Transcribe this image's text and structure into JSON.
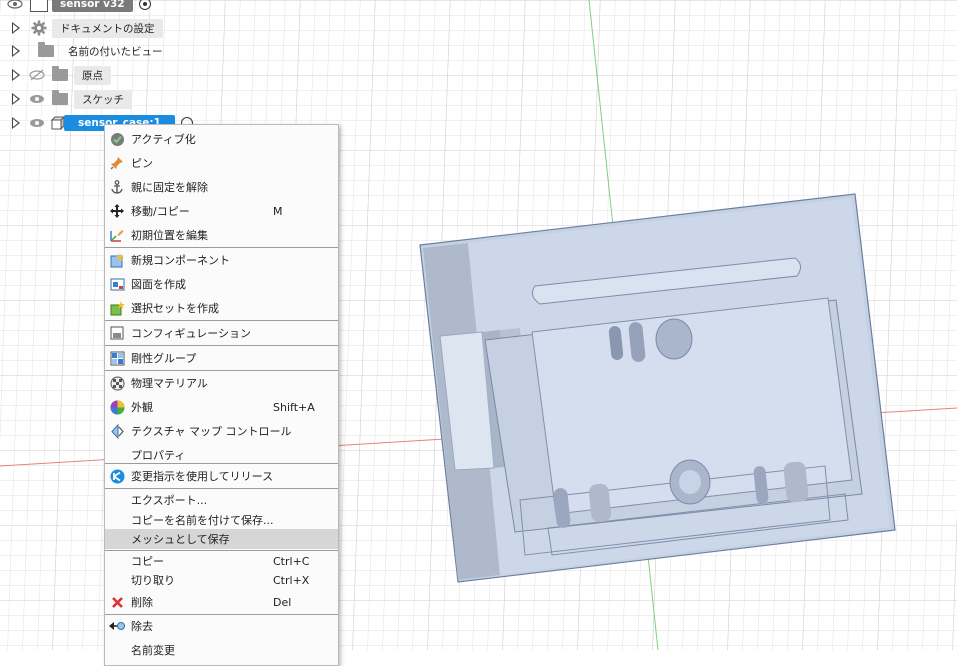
{
  "browser": {
    "root": {
      "label": "sensor v32"
    },
    "items": [
      {
        "label": "ドキュメントの設定",
        "icon": "gear-icon"
      },
      {
        "label": "名前の付いたビュー",
        "icon": "folder-icon"
      },
      {
        "label": "原点",
        "icon": "folder-icon",
        "visibility": "hidden"
      },
      {
        "label": "スケッチ",
        "icon": "folder-icon",
        "visibility": "visible"
      },
      {
        "label": "sensor_case:1",
        "icon": "component-icon",
        "visibility": "visible",
        "selected": true
      }
    ]
  },
  "context_menu": {
    "items": [
      {
        "label": "アクティブ化",
        "icon": "activate-check-icon",
        "shortcut": ""
      },
      {
        "label": "ピン",
        "icon": "pin-icon",
        "shortcut": ""
      },
      {
        "label": "親に固定を解除",
        "icon": "anchor-icon",
        "shortcut": ""
      },
      {
        "label": "移動/コピー",
        "icon": "move-icon",
        "shortcut": "M"
      },
      {
        "label": "初期位置を編集",
        "icon": "edit-position-icon",
        "shortcut": ""
      },
      {
        "label": "新規コンポーネント",
        "icon": "new-component-icon",
        "shortcut": ""
      },
      {
        "label": "図面を作成",
        "icon": "drawing-icon",
        "shortcut": ""
      },
      {
        "label": "選択セットを作成",
        "icon": "selection-set-icon",
        "shortcut": ""
      },
      {
        "label": "コンフィギュレーション",
        "icon": "configuration-icon",
        "shortcut": ""
      },
      {
        "label": "剛性グループ",
        "icon": "rigid-group-icon",
        "shortcut": ""
      },
      {
        "label": "物理マテリアル",
        "icon": "material-icon",
        "shortcut": ""
      },
      {
        "label": "外観",
        "icon": "appearance-icon",
        "shortcut": "Shift+A"
      },
      {
        "label": "テクスチャ マップ コントロール",
        "icon": "texture-map-icon",
        "shortcut": ""
      },
      {
        "label": "プロパティ",
        "icon": "",
        "shortcut": ""
      },
      {
        "label": "変更指示を使用してリリース",
        "icon": "release-icon",
        "shortcut": ""
      },
      {
        "label": "エクスポート...",
        "icon": "",
        "shortcut": ""
      },
      {
        "label": "コピーを名前を付けて保存...",
        "icon": "",
        "shortcut": ""
      },
      {
        "label": "メッシュとして保存",
        "icon": "",
        "shortcut": "",
        "highlighted": true
      },
      {
        "label": "コピー",
        "icon": "",
        "shortcut": "Ctrl+C"
      },
      {
        "label": "切り取り",
        "icon": "",
        "shortcut": "Ctrl+X"
      },
      {
        "label": "削除",
        "icon": "delete-x-icon",
        "shortcut": "Del"
      },
      {
        "label": "除去",
        "icon": "remove-icon",
        "shortcut": ""
      },
      {
        "label": "名前変更",
        "icon": "",
        "shortcut": ""
      }
    ]
  },
  "colors": {
    "selection": "#1a8de0",
    "model_face": "#c6d2e6",
    "grid": "#d9d9d9",
    "axis_red": "#e88080",
    "axis_green": "#7fd07f"
  }
}
